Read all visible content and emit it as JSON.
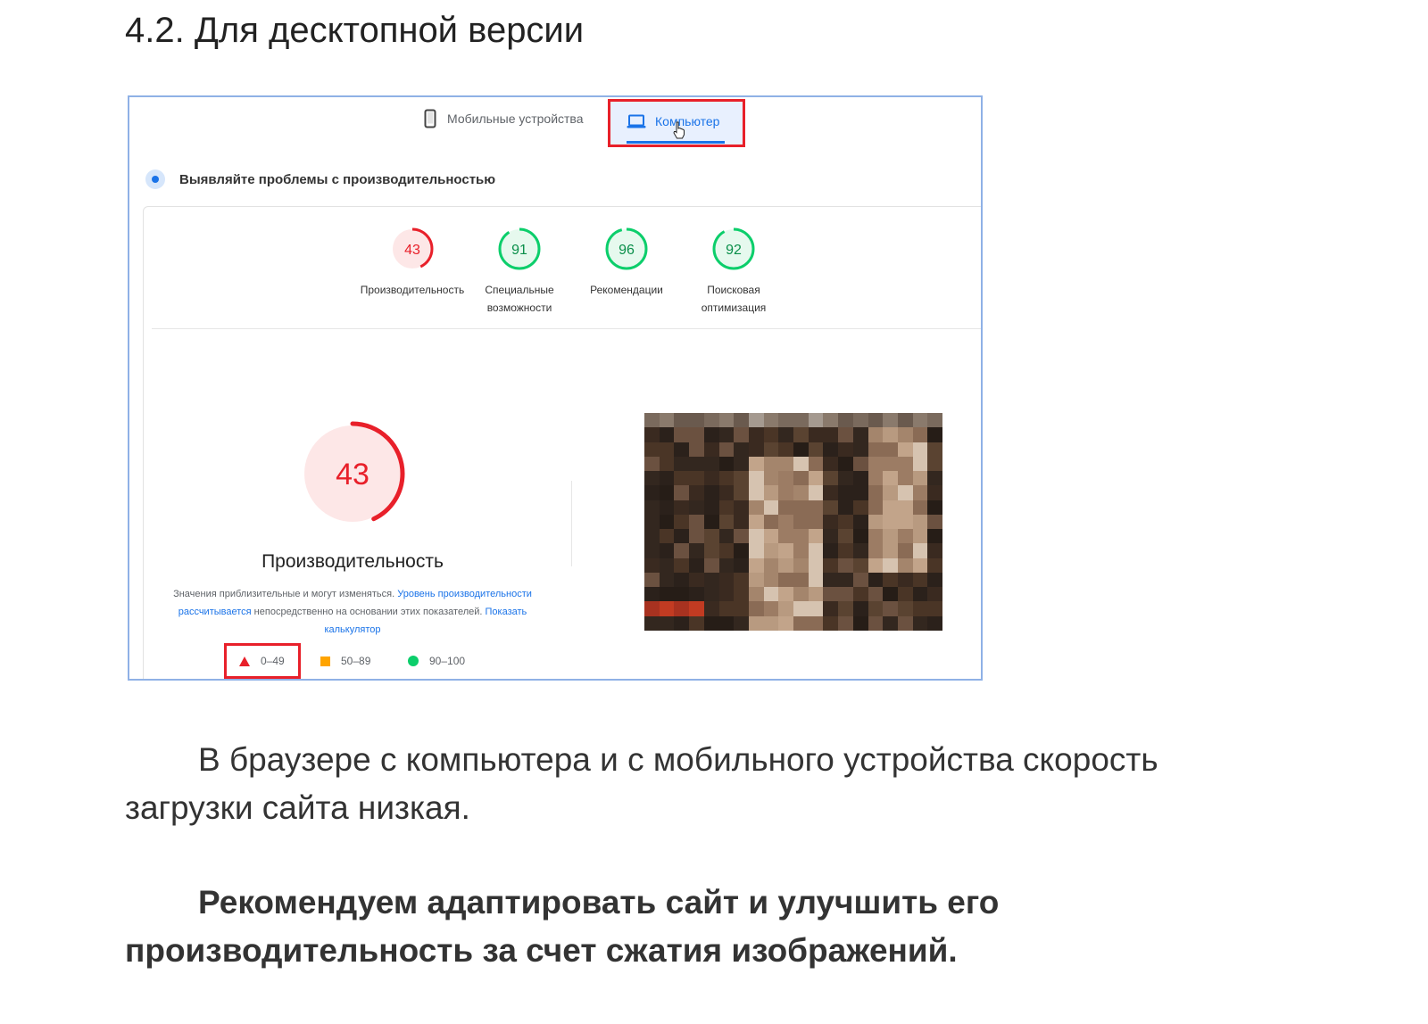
{
  "heading": "4.2. Для десктопной версии",
  "tabs": {
    "mobile_label": "Мобильные устройства",
    "desktop_label": "Компьютер",
    "active": "desktop"
  },
  "section_title": "Выявляйте проблемы с производительностью",
  "scores": [
    {
      "value": 43,
      "caption_line1": "Производительность",
      "caption_line2": "",
      "status": "bad"
    },
    {
      "value": 91,
      "caption_line1": "Специальные",
      "caption_line2": "возможности",
      "status": "good"
    },
    {
      "value": 96,
      "caption_line1": "Рекомендации",
      "caption_line2": "",
      "status": "good"
    },
    {
      "value": 92,
      "caption_line1": "Поисковая",
      "caption_line2": "оптимизация",
      "status": "good"
    }
  ],
  "performance": {
    "value": 43,
    "title": "Производительность",
    "note_part1": "Значения приблизительные и могут изменяться. ",
    "note_link1": "Уровень производительности рассчитывается",
    "note_part2": " непосредственно на основании этих показателей. ",
    "note_link2": "Показать калькулятор"
  },
  "legend": [
    {
      "range": "0–49",
      "shape": "triangle",
      "color": "#e8202a"
    },
    {
      "range": "50–89",
      "shape": "square",
      "color": "#ffa400"
    },
    {
      "range": "90–100",
      "shape": "circle",
      "color": "#0cce6b"
    }
  ],
  "colors": {
    "bad": "#e8202a",
    "bad_bg": "#fde7e7",
    "good": "#0cce6b",
    "good_text": "#0a8f4a",
    "good_bg": "#e6f9ee",
    "accent": "#1a73e8"
  },
  "paragraph_1": "В браузере с компьютера и с мобильного устройства скорость загрузки сайта низкая.",
  "paragraph_2": "Рекомендуем адаптировать сайт и улучшить его производительность за счет сжатия изображений."
}
